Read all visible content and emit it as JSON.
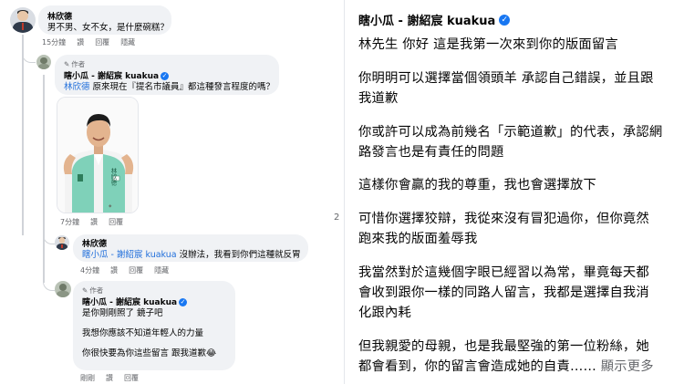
{
  "left": {
    "comment1": {
      "author": "林欣德",
      "text": "男不男、女不女，是什麼碗糕？",
      "time": "15分鐘",
      "like": "讚",
      "reply": "回覆",
      "hide": "隱藏"
    },
    "reply1": {
      "badge": "作者",
      "author": "瞎小瓜 - 謝紹宸 kuakua",
      "mention": "林欣德",
      "text": "原來現在『提名市議員』都這種發言程度的嗎？",
      "photo_name": "林欣德",
      "photo_vest": "林欣德",
      "time": "7分鐘",
      "like": "讚",
      "reply": "回覆"
    },
    "reply2": {
      "author": "林欣德",
      "mention": "瞎小瓜 - 謝紹宸 kuakua",
      "text": "沒辦法，我看到你們這種就反胃...",
      "time": "4分鐘",
      "like": "讚",
      "reply": "回覆",
      "hide": "隱藏"
    },
    "reply3": {
      "badge": "作者",
      "author": "瞎小瓜 - 謝紹宸 kuakua",
      "line1": "是你剛剛照了 鏡子吧",
      "line2": "我想你應該不知道年輕人的力量",
      "line3": "你很快要為你這些留言 跟我道歉😂",
      "time": "剛剛",
      "like": "讚",
      "reply": "回覆"
    }
  },
  "page_marker": "2",
  "right": {
    "author": "瞎小瓜 - 謝紹宸 kuakua",
    "lines": [
      "林先生 你好 這是我第一次來到你的版面留言",
      "你明明可以選擇當個領頭羊 承認自己錯誤，並且跟",
      "我道歉",
      "你或許可以成為前幾名「示範道歉」的代表，承認網",
      "路發言也是有責任的問題",
      "這樣你會贏的我的尊重，我也會選擇放下",
      "可惜你選擇狡辯，我從來沒有冒犯過你，但你竟然",
      "跑來我的版面羞辱我",
      "我當然對於這幾個字眼已經習以為常，畢竟每天都",
      "會收到跟你一樣的同路人留言，我都是選擇自我消",
      "化跟內耗",
      "但我親愛的母親，也是我最堅強的第一位粉絲，她",
      "都會看到，你的留言會造成她的自責……"
    ],
    "see_more": "顯示更多"
  },
  "colors": {
    "bubble": "#f0f2f5",
    "link": "#216fdb",
    "verified": "#1877f2",
    "vest": "#7fd1b9"
  },
  "icons": [
    "verified-badge-icon",
    "pen-author-icon",
    "avatar-image"
  ]
}
